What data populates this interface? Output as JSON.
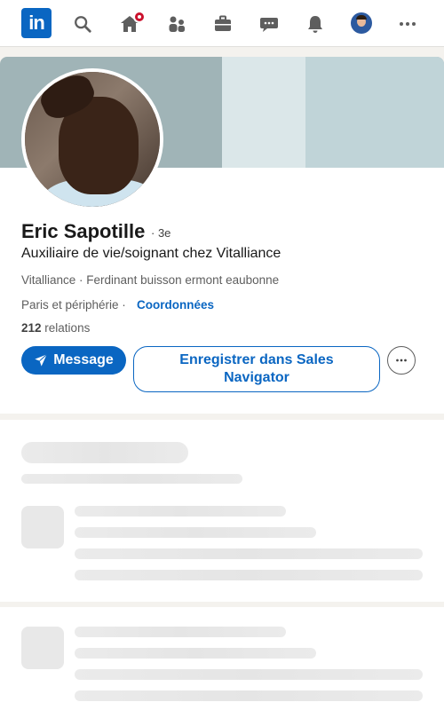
{
  "nav": {
    "logo_text": "in",
    "icons": [
      "linkedin-logo",
      "search-icon",
      "home-icon",
      "network-icon",
      "jobs-icon",
      "messaging-icon",
      "notifications-icon",
      "avatar",
      "more-icon"
    ]
  },
  "profile": {
    "name": "Eric Sapotille",
    "degree": "· 3e",
    "headline": "Auxiliaire de vie/soignant chez Vitalliance",
    "company_line": "Vitalliance · Ferdinant buisson ermont eaubonne",
    "location": "Paris et périphérie ·",
    "contact_label": "Coordonnées",
    "connections_count": "212",
    "connections_label": "relations"
  },
  "actions": {
    "message_label": "Message",
    "sales_navigator_label": "Enregistrer dans Sales Navigator"
  },
  "colors": {
    "brand": "#0a66c2",
    "notification": "#cb112d",
    "background": "#f4f2ee"
  }
}
